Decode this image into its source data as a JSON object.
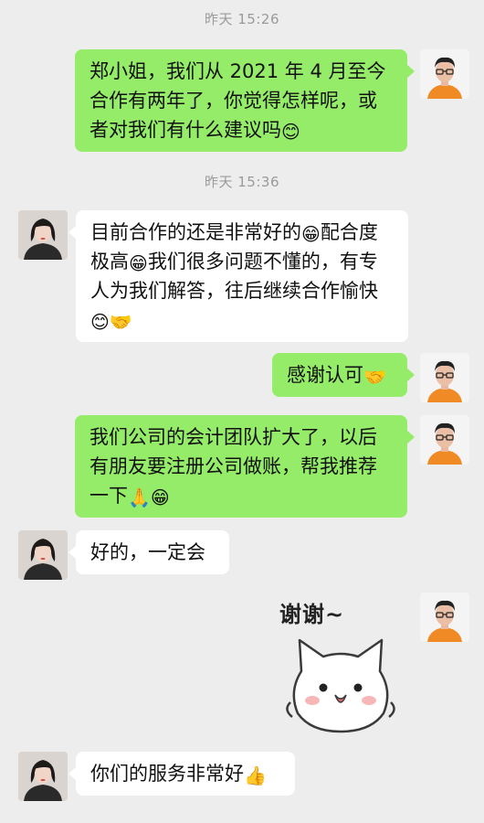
{
  "timestamps": [
    "昨天 15:26",
    "昨天 15:36"
  ],
  "messages": [
    {
      "side": "me",
      "text": "郑小姐，我们从 2021 年 4 月至今合作有两年了，你觉得怎样呢，或者对我们有什么建议吗",
      "emoji": "😊"
    },
    {
      "side": "them",
      "text_a": "目前合作的还是非常好的",
      "emoji_a": "😁",
      "text_b": "配合度极高",
      "emoji_b": "😁",
      "text_c": "我们很多问题不懂的，有专人为我们解答，往后继续合作愉快",
      "emoji_c": "😊🤝"
    },
    {
      "side": "me",
      "text": "感谢认可",
      "emoji": "🤝"
    },
    {
      "side": "me",
      "text": "我们公司的会计团队扩大了，以后有朋友要注册公司做账，帮我推荐一下",
      "emoji": "🙏😁"
    },
    {
      "side": "them",
      "text": "好的，一定会"
    },
    {
      "side": "me",
      "sticker_text": "谢谢~",
      "sticker": "cat-sticker"
    },
    {
      "side": "them",
      "text": "你们的服务非常好",
      "emoji": "👍"
    }
  ],
  "colors": {
    "my_bubble": "#95ec69",
    "their_bubble": "#ffffff",
    "background": "#ededed"
  }
}
